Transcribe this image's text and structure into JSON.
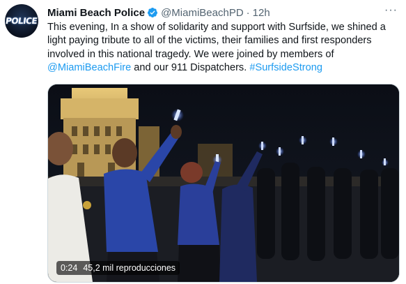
{
  "tweet": {
    "avatar_text": "POLICE",
    "display_name": "Miami Beach Police",
    "handle": "@MiamiBeachPD",
    "separator": "·",
    "time": "12h",
    "more": "···",
    "text_plain": "This evening, In a show of solidarity and support with Surfside, we shined a light paying tribute to all of the victims, their families and first responders involved in this national tragedy. We were joined by members of",
    "mention": "@MiamiBeachFire",
    "text_mid": " and our 911 Dispatchers. ",
    "hashtag": "#SurfsideStrong"
  },
  "video": {
    "duration": "0:24",
    "views": "45,2 mil reproducciones"
  },
  "colors": {
    "accent": "#1d9bf0",
    "text": "#0f1419",
    "muted": "#536471"
  },
  "icons": [
    "verified-badge-icon",
    "more-options-icon"
  ]
}
